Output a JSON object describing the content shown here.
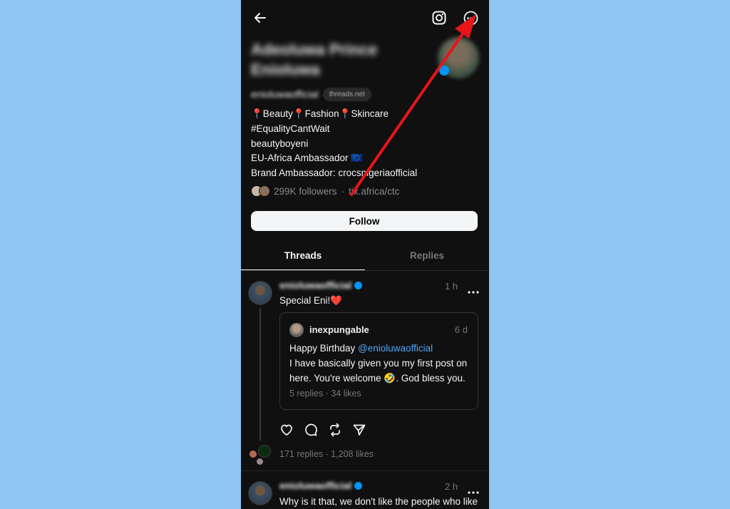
{
  "profile": {
    "name": "Adeoluwa Prince Enioluwa",
    "handle": "enioluwaofficial",
    "domain": "threads.net",
    "bio": [
      "📍Beauty📍Fashion📍Skincare",
      "#EqualityCantWait",
      "beautyboyeni",
      "EU-Africa Ambassador 🇪🇺",
      "Brand Ambassador: crocsnigeriaofficial"
    ],
    "followers": "299K followers",
    "separator": "·",
    "link": "tix.africa/ctc",
    "follow_label": "Follow"
  },
  "tabs": [
    {
      "label": "Threads",
      "active": true
    },
    {
      "label": "Replies",
      "active": false
    }
  ],
  "posts": [
    {
      "user": "enioluwaofficial",
      "time": "1 h",
      "text": "Special Eni!❤️",
      "quote": {
        "user": "inexpungable",
        "time": "6 d",
        "line1_prefix": "Happy Birthday ",
        "mention": "@enioluwaofficial",
        "line2": "I have basically given you my first post on here. You're welcome 🤣. God bless you.",
        "stats": "5 replies · 34 likes"
      },
      "stats": "171 replies · 1,208 likes"
    },
    {
      "user": "enioluwaofficial",
      "time": "2 h",
      "text": "Why is it that, we don't like the people who like"
    }
  ],
  "colors": {
    "page_bg": "#8ec5f2",
    "app_bg": "#101010",
    "verified": "#0095f6",
    "mention": "#4ea6f5",
    "annotation_arrow": "#e8141b"
  },
  "icons": [
    "back-arrow-icon",
    "instagram-icon",
    "more-options-icon",
    "heart-icon",
    "comment-icon",
    "repost-icon",
    "share-icon",
    "verified-badge-icon"
  ]
}
